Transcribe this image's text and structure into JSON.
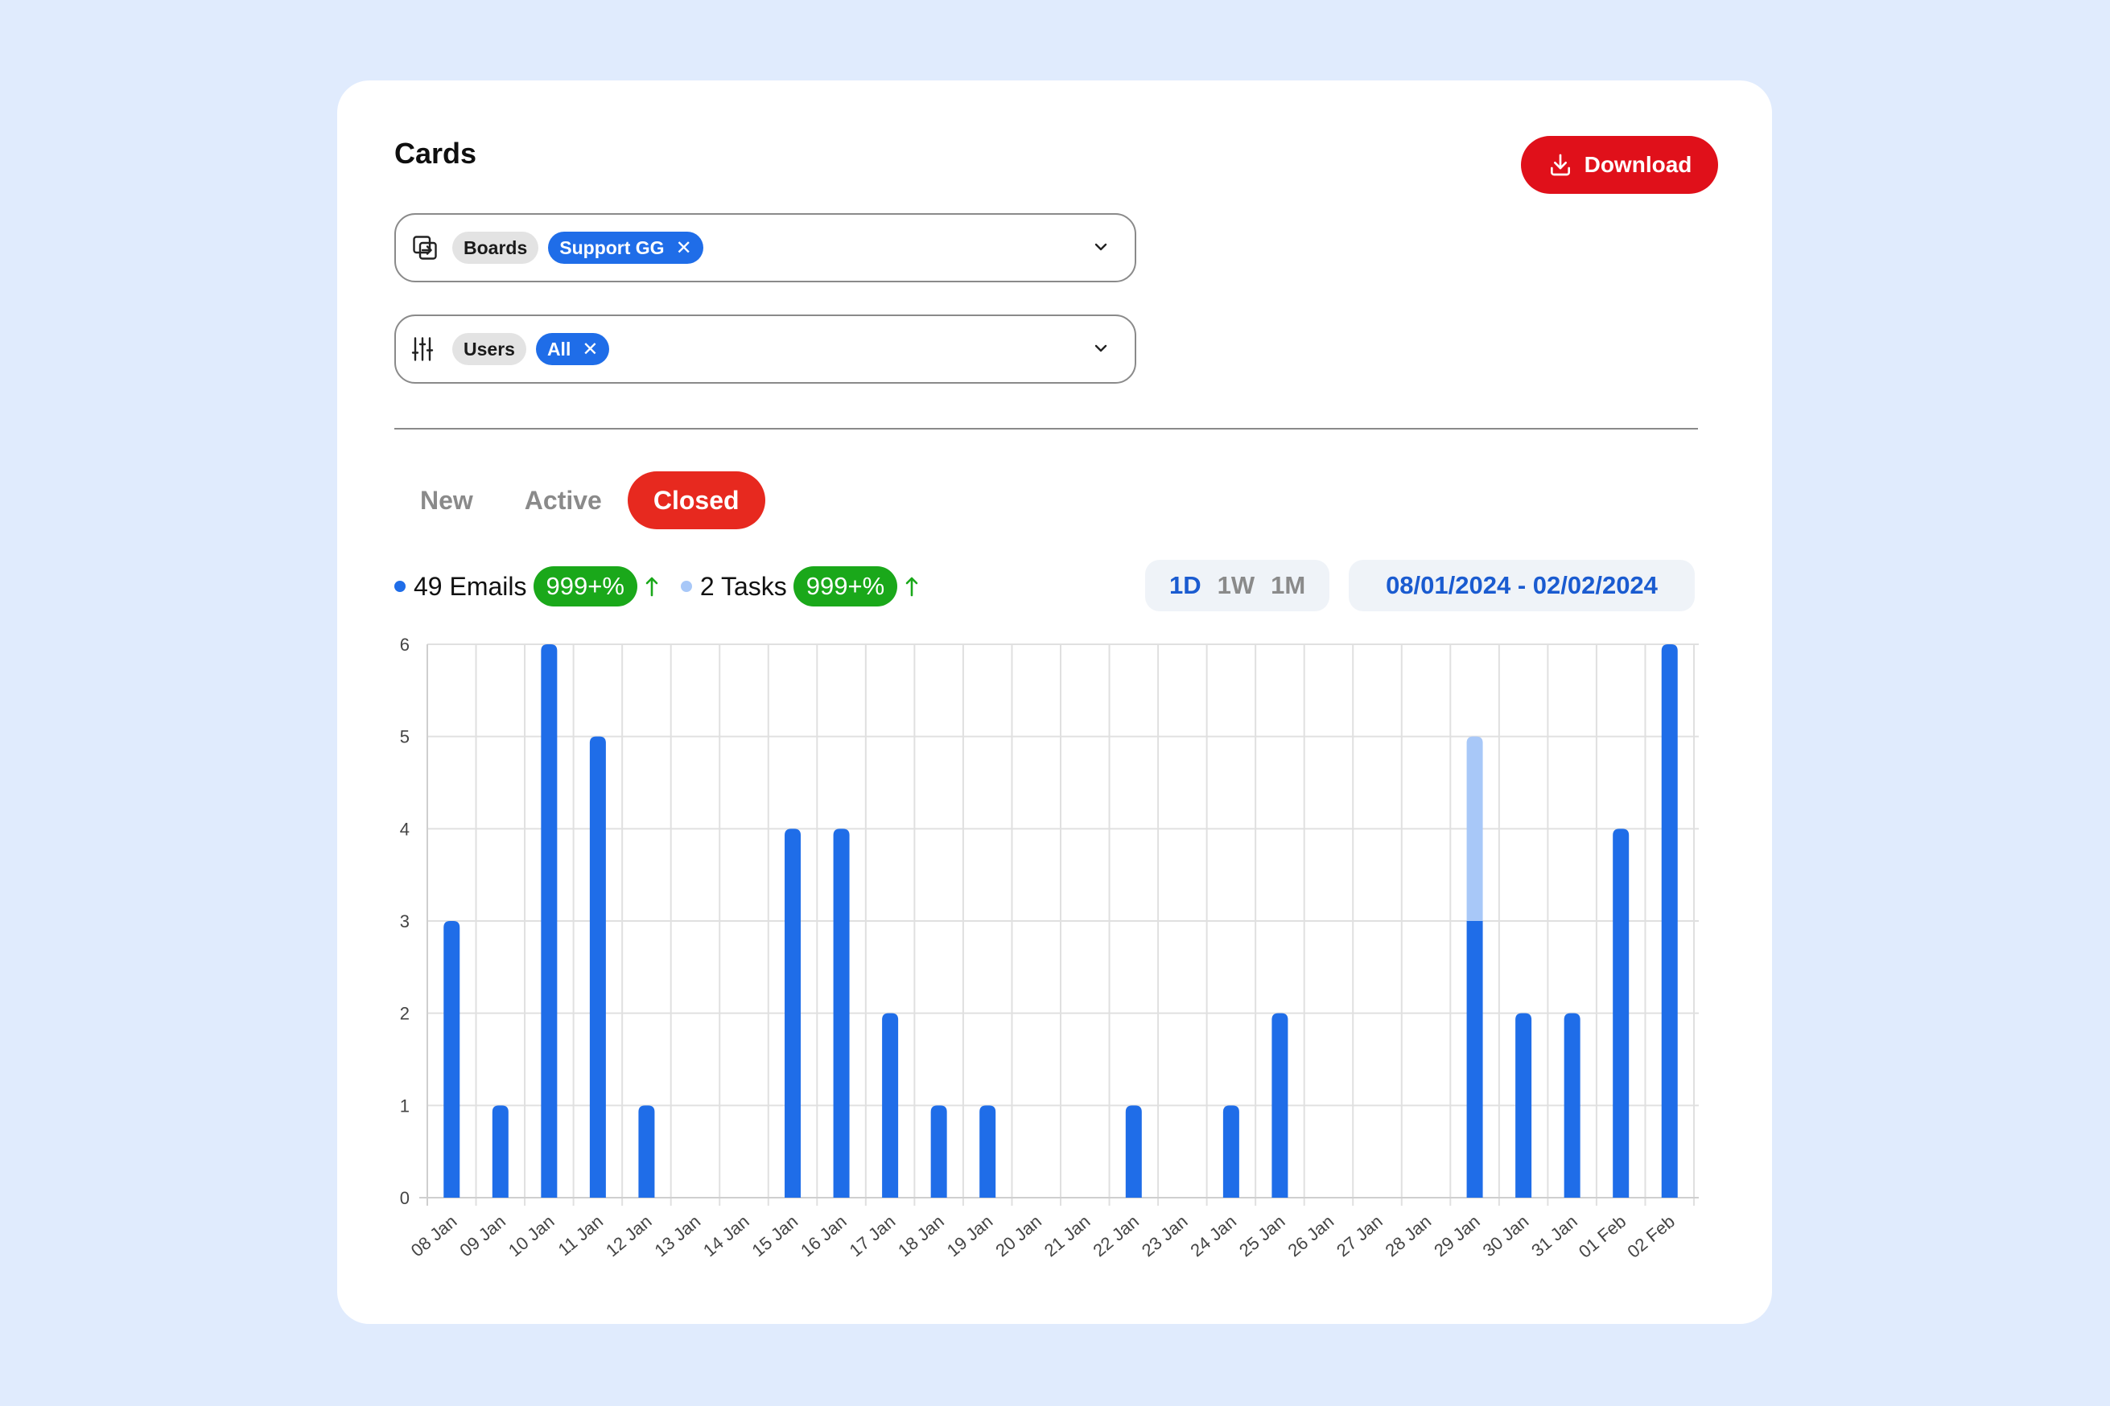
{
  "page": {
    "title": "Cards",
    "download_label": "Download"
  },
  "filters": [
    {
      "icon": "boards-icon",
      "label": "Boards",
      "value": "Support GG"
    },
    {
      "icon": "sliders-icon",
      "label": "Users",
      "value": "All"
    }
  ],
  "tabs": [
    {
      "label": "New",
      "active": false
    },
    {
      "label": "Active",
      "active": false
    },
    {
      "label": "Closed",
      "active": true
    }
  ],
  "legend": [
    {
      "label": "49 Emails",
      "badge": "999+%",
      "color": "#1f6de8"
    },
    {
      "label": "2 Tasks",
      "badge": "999+%",
      "color": "#a8c8f8"
    }
  ],
  "ranges": [
    {
      "label": "1D",
      "active": true
    },
    {
      "label": "1W",
      "active": false
    },
    {
      "label": "1M",
      "active": false
    }
  ],
  "date_range": "08/01/2024 - 02/02/2024",
  "colors": {
    "accent": "#e7291f",
    "download": "#e0101a",
    "chip": "#1f6de8",
    "badge": "#1aa81a",
    "emails": "#1f6de8",
    "tasks": "#a8c8f8"
  },
  "chart_data": {
    "type": "bar",
    "stacked": true,
    "categories": [
      "08 Jan",
      "09 Jan",
      "10 Jan",
      "11 Jan",
      "12 Jan",
      "13 Jan",
      "14 Jan",
      "15 Jan",
      "16 Jan",
      "17 Jan",
      "18 Jan",
      "19 Jan",
      "20 Jan",
      "21 Jan",
      "22 Jan",
      "23 Jan",
      "24 Jan",
      "25 Jan",
      "26 Jan",
      "27 Jan",
      "28 Jan",
      "29 Jan",
      "30 Jan",
      "31 Jan",
      "01 Feb",
      "02 Feb"
    ],
    "series": [
      {
        "name": "Emails",
        "color": "#1f6de8",
        "values": [
          3,
          1,
          6,
          5,
          1,
          0,
          0,
          4,
          4,
          2,
          1,
          1,
          0,
          0,
          1,
          0,
          1,
          2,
          0,
          0,
          0,
          3,
          2,
          2,
          4,
          6
        ]
      },
      {
        "name": "Tasks",
        "color": "#a8c8f8",
        "values": [
          0,
          0,
          0,
          0,
          0,
          0,
          0,
          0,
          0,
          0,
          0,
          0,
          0,
          0,
          0,
          0,
          0,
          0,
          0,
          0,
          0,
          2,
          0,
          0,
          0,
          0
        ]
      }
    ],
    "yticks": [
      0,
      1,
      2,
      3,
      4,
      5,
      6
    ],
    "ylim": [
      0,
      6
    ],
    "grid": true,
    "title": "",
    "xlabel": "",
    "ylabel": ""
  }
}
